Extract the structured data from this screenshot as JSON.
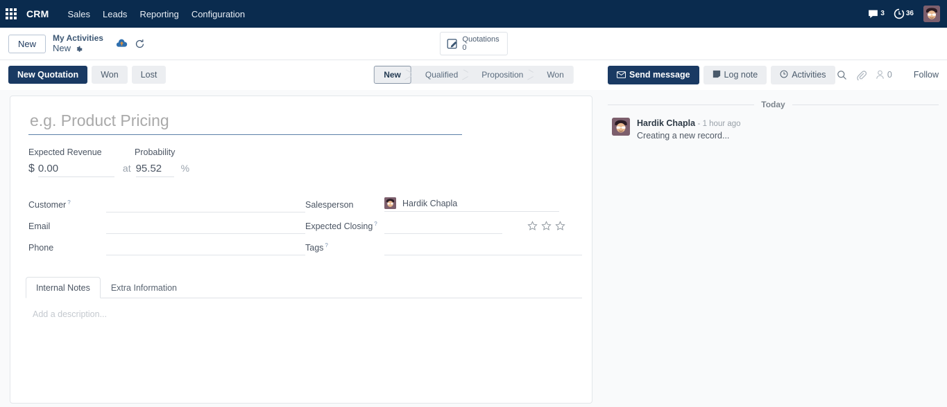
{
  "navbar": {
    "apps_icon": "apps-grid-icon",
    "brand": "CRM",
    "menus": [
      "Sales",
      "Leads",
      "Reporting",
      "Configuration"
    ],
    "systray": {
      "messages_icon": "comment-icon",
      "messages_count": "3",
      "activities_icon": "clock-icon",
      "activities_count": "36",
      "avatar_icon": "user-avatar"
    }
  },
  "control_panel": {
    "new_button": "New",
    "breadcrumb_parent": "My Activities",
    "breadcrumb_current": "New",
    "gear_icon": "gear-icon",
    "save_icon": "cloud-save-icon",
    "discard_icon": "discard-undo-icon",
    "stat_button": {
      "icon": "pencil-square-icon",
      "label": "Quotations",
      "value": "0"
    }
  },
  "action_bar": {
    "buttons": [
      {
        "label": "New Quotation",
        "style": "primary"
      },
      {
        "label": "Won",
        "style": "secondary"
      },
      {
        "label": "Lost",
        "style": "secondary"
      }
    ],
    "statusbar": {
      "stages": [
        "New",
        "Qualified",
        "Proposition",
        "Won"
      ],
      "active": "New"
    },
    "chatter_buttons": [
      {
        "label": "Send message",
        "icon": "envelope-icon",
        "style": "primary"
      },
      {
        "label": "Log note",
        "icon": "note-icon",
        "style": "secondary"
      },
      {
        "label": "Activities",
        "icon": "clock-icon",
        "style": "secondary"
      }
    ],
    "follow_zone": {
      "search_icon": "search-icon",
      "attachment_icon": "paperclip-icon",
      "followers_icon": "person-icon",
      "followers_count": "0",
      "follow_label": "Follow"
    }
  },
  "form": {
    "title_placeholder": "e.g. Product Pricing",
    "title_value": "",
    "expected_revenue": {
      "label": "Expected Revenue",
      "currency": "$",
      "value": "0.00"
    },
    "probability": {
      "label": "Probability",
      "prefix": "at",
      "value": "95.52",
      "suffix": "%"
    },
    "left_fields": [
      {
        "label": "Customer",
        "value": "",
        "help": "?"
      },
      {
        "label": "Email",
        "value": "",
        "help": ""
      },
      {
        "label": "Phone",
        "value": "",
        "help": ""
      }
    ],
    "salesperson": {
      "label": "Salesperson",
      "value": "Hardik Chapla",
      "avatar_icon": "user-avatar"
    },
    "expected_closing": {
      "label": "Expected Closing",
      "value": "",
      "help": "?",
      "priority_stars": 3,
      "priority_filled": 0
    },
    "tags": {
      "label": "Tags",
      "value": "",
      "help": "?"
    },
    "notebook": {
      "tabs": [
        {
          "label": "Internal Notes",
          "active": true
        },
        {
          "label": "Extra Information",
          "active": false
        }
      ],
      "description_placeholder": "Add a description..."
    }
  },
  "chatter": {
    "date_separator": "Today",
    "messages": [
      {
        "author": "Hardik Chapla",
        "time": "- 1 hour ago",
        "body": "Creating a new record...",
        "avatar_icon": "user-avatar"
      }
    ]
  },
  "colors": {
    "navbar_bg": "#0a2b4e",
    "primary": "#1a3a63",
    "secondary": "#eceef1",
    "page_bg": "#f9fafb",
    "sheet_bg": "#ffffff"
  }
}
